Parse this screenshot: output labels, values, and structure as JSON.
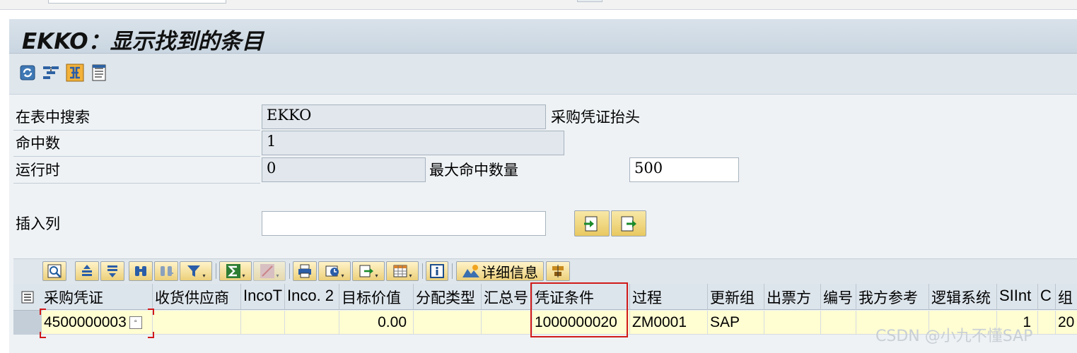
{
  "window": {
    "title": "EKKO：显示找到的条目"
  },
  "toolbar_icons": [
    "refresh-icon",
    "settings-icon",
    "check-table-icon",
    "list-icon"
  ],
  "selection": {
    "table_label": "在表中搜索",
    "table_value": "EKKO",
    "table_description": "采购凭证抬头",
    "hits_label": "命中数",
    "hits_value": "1",
    "runtime_label": "运行时",
    "runtime_value": "0",
    "max_hits_label": "最大命中数量",
    "max_hits_value": "500",
    "insert_column_label": "插入列",
    "insert_column_value": ""
  },
  "alv_toolbar": {
    "icons": [
      "details-icon",
      "sort-ascending-icon",
      "sort-descending-icon",
      "find-icon",
      "find-next-icon",
      "filter-icon",
      "sum-icon",
      "subtotal-icon",
      "print-icon",
      "views-icon",
      "export-icon",
      "layout-icon",
      "info-icon",
      "graphic-icon",
      "abc-analysis-icon"
    ],
    "detail_label": "详细信息"
  },
  "table": {
    "columns": [
      "采购凭证",
      "收货供应商",
      "IncoT",
      "Inco. 2",
      "目标价值",
      "分配类型",
      "汇总号",
      "凭证条件",
      "过程",
      "更新组",
      "出票方",
      "编号",
      "我方参考",
      "逻辑系统",
      "SIInt",
      "C",
      "组"
    ],
    "rows": [
      [
        "4500000003",
        "",
        "",
        "",
        "0.00",
        "",
        "",
        "1000000020",
        "ZM0001",
        "SAP",
        "",
        "",
        "",
        "",
        "1",
        "",
        "20"
      ]
    ]
  },
  "watermark": "CSDN @小九不懂SAP"
}
